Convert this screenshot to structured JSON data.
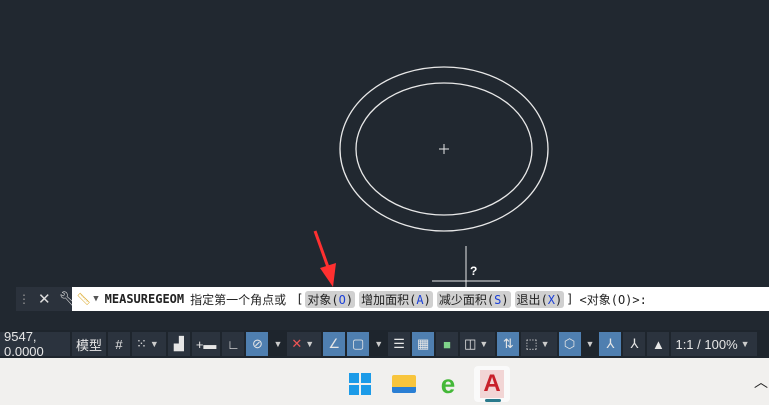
{
  "canvas": {
    "cursor_tooltip": "?"
  },
  "command_line": {
    "command": "MEASUREGEOM",
    "prompt": "指定第一个角点或",
    "bracket_open": "[",
    "options": [
      {
        "label": "对象",
        "key": "O"
      },
      {
        "label": "增加面积",
        "key": "A"
      },
      {
        "label": "减少面积",
        "key": "S"
      },
      {
        "label": "退出",
        "key": "X"
      }
    ],
    "bracket_close": "]",
    "default": "<对象(O)>:"
  },
  "status_bar": {
    "coordinates": "9547, 0.0000",
    "model_label": "模型",
    "scale": "1:1 / 100%"
  },
  "colors": {
    "canvas_bg": "#212830",
    "accent": "#4f7fb0",
    "arrow": "#ff3030"
  }
}
